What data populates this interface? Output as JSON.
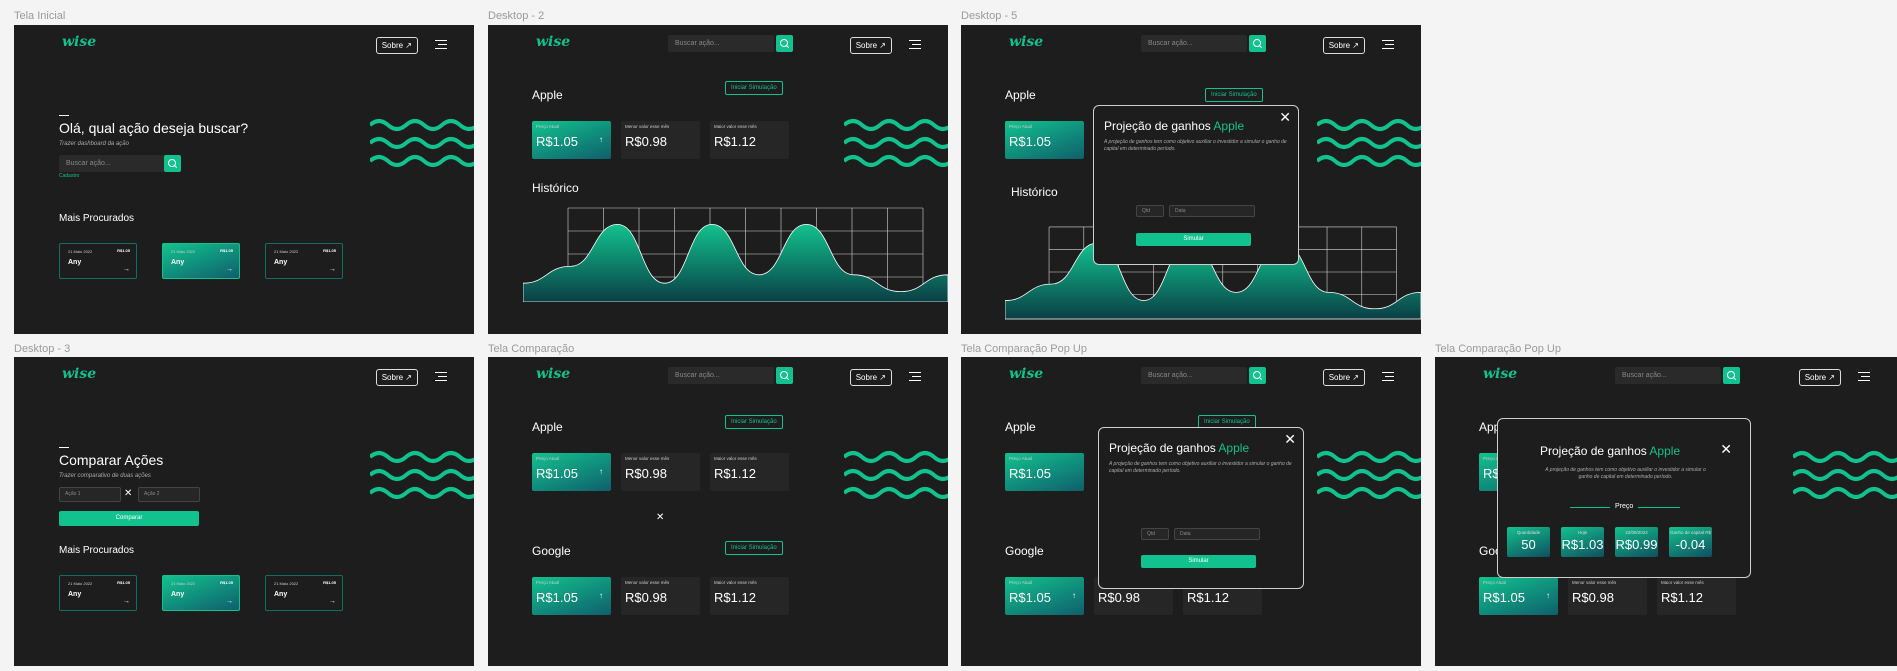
{
  "frames": {
    "f1": {
      "label": "Tela Inicial"
    },
    "f2": {
      "label": "Desktop - 2"
    },
    "f3": {
      "label": "Desktop - 5"
    },
    "f4": {
      "label": "Desktop - 3"
    },
    "f5": {
      "label": "Tela Comparação"
    },
    "f6": {
      "label": "Tela Comparação Pop Up"
    },
    "f7": {
      "label": "Tela Comparação Pop Up"
    }
  },
  "common": {
    "logo": "wise",
    "sobre": "Sobre ↗",
    "search_placeholder": "Buscar ação...",
    "iniciar": "Iniciar Simulação",
    "apple": "Apple",
    "google": "Google",
    "historico": "Histórico",
    "mais": "Mais Procurados",
    "preco_atual": "Preço Atual",
    "menor": "Menor valor esse mês",
    "maior": "Maior valor esse mês",
    "v1": "R$1.05",
    "v2": "R$0.98",
    "v3": "R$1.12",
    "arrow": "↑"
  },
  "home": {
    "title": "Olá, qual ação deseja buscar?",
    "subtitle": "Trazer dashboard da ação",
    "link": "Cadastro",
    "compare_title": "Comparar Ações",
    "compare_sub": "Trazer comparativo de duas ações",
    "acao1": "Ação 1",
    "acao2": "Ação 2",
    "comparar": "Comparar",
    "x": "✕",
    "cards": [
      {
        "date": "21 Maio 2022",
        "price": "R$1.05",
        "name": "Any"
      },
      {
        "date": "21 Maio 2022",
        "price": "R$1.05",
        "name": "Any"
      },
      {
        "date": "21 Maio 2022",
        "price": "R$1.05",
        "name": "Any"
      }
    ]
  },
  "modal": {
    "title": "Projeção de ganhos",
    "brand": "Apple",
    "desc": "A projeção de ganhos tem como objetivo auxiliar o investidor a simular o ganho de capital em determinado período.",
    "qtd": "Qtd",
    "data": "Data",
    "simular": "Simular",
    "close": "✕",
    "preco": "Preço",
    "results": [
      {
        "t": "Quantidade",
        "v": "50"
      },
      {
        "t": "Hoje",
        "v": "R$1.03"
      },
      {
        "t": "22/08/2022",
        "v": "R$0.99"
      },
      {
        "t": "Ganho de capital R$",
        "v": "-0.04"
      }
    ]
  },
  "chart_data": {
    "type": "area",
    "x": [
      0,
      1,
      2,
      3,
      4,
      5,
      6,
      7,
      8,
      9
    ],
    "y": [
      0.2,
      0.4,
      0.9,
      0.2,
      0.9,
      0.3,
      0.9,
      0.3,
      0.1,
      0.3
    ]
  }
}
